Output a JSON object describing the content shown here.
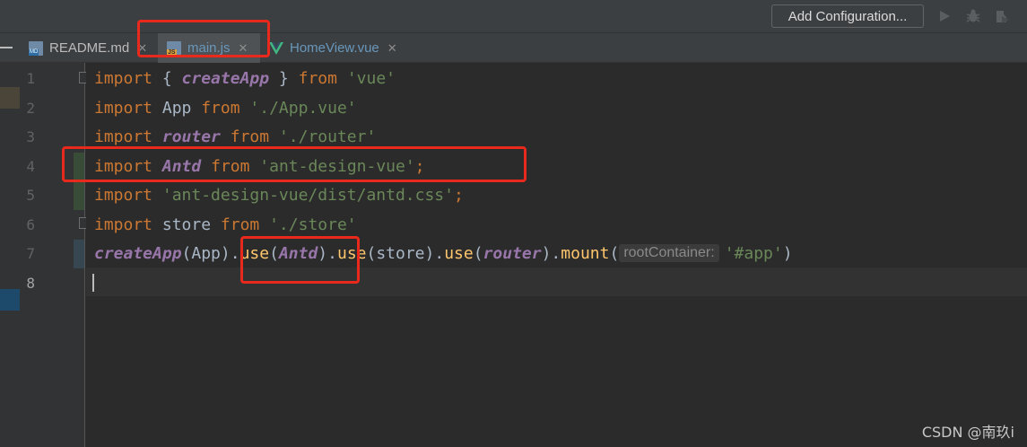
{
  "toolbar": {
    "config_label": "Add Configuration...",
    "icons": [
      "run-icon",
      "debug-icon",
      "coverage-icon"
    ]
  },
  "tabs": [
    {
      "label": "README.md",
      "icon": "markdown-file-icon",
      "badge": "MD",
      "active": false
    },
    {
      "label": "main.js",
      "icon": "javascript-file-icon",
      "badge": "JS",
      "active": true
    },
    {
      "label": "HomeView.vue",
      "icon": "vue-file-icon",
      "active": false
    }
  ],
  "line_numbers": [
    "1",
    "2",
    "3",
    "4",
    "5",
    "6",
    "7",
    "8"
  ],
  "code": {
    "l1": {
      "kw": "import",
      "p1": " { ",
      "name": "createApp",
      "p2": " } ",
      "kw2": "from",
      "sp": " ",
      "str": "'vue'"
    },
    "l2": {
      "kw": "import",
      "p1": " App ",
      "kw2": "from",
      "sp": " ",
      "str": "'./App.vue'"
    },
    "l3": {
      "kw": "import",
      "sp0": " ",
      "name": "router",
      "sp1": " ",
      "kw2": "from",
      "sp": " ",
      "str": "'./router'"
    },
    "l4": {
      "kw": "import",
      "sp0": " ",
      "name": "Antd",
      "sp1": " ",
      "kw2": "from",
      "sp": " ",
      "str": "'ant-design-vue'",
      "semi": ";"
    },
    "l5": {
      "kw": "import",
      "sp": " ",
      "str": "'ant-design-vue/dist/antd.css'",
      "semi": ";"
    },
    "l6": {
      "kw": "import",
      "p1": " store ",
      "kw2": "from",
      "sp": " ",
      "str": "'./store'"
    },
    "l7": {
      "f0": "createApp",
      "p0": "(App).",
      "f1": "use",
      "p1": "(",
      "a1": "Antd",
      "p2": ").",
      "f2": "use",
      "p3": "(store).",
      "f3": "use",
      "p4": "(",
      "a2": "router",
      "p5": ").",
      "f4": "mount",
      "p6": "(",
      "hint": "rootContainer:",
      "str": "'#app'",
      "p7": ")"
    }
  },
  "watermark": "CSDN @南玖i",
  "colors": {
    "keyword": "#cc7832",
    "string": "#6a8759",
    "identifier": "#9876aa",
    "function": "#ffc66d",
    "annotation": "#e8291c"
  }
}
